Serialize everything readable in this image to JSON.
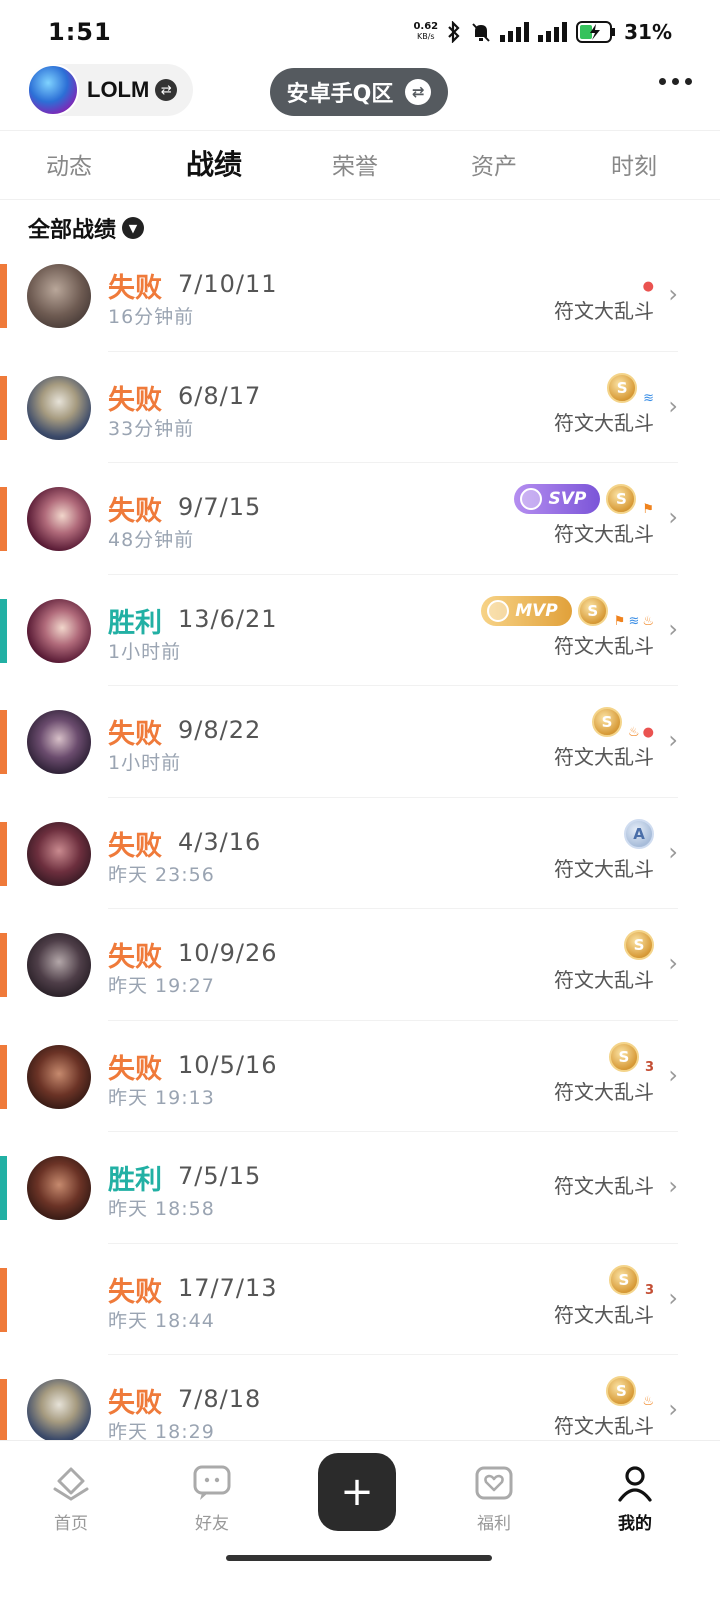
{
  "status_bar": {
    "time": "1:51",
    "net_speed": "0.62",
    "net_unit": "KB/s",
    "battery": "31%"
  },
  "header": {
    "account_name": "LOLM",
    "server": "安卓手Q区"
  },
  "tabs": [
    {
      "label": "动态",
      "active": false
    },
    {
      "label": "战绩",
      "active": true
    },
    {
      "label": "荣誉",
      "active": false
    },
    {
      "label": "资产",
      "active": false
    },
    {
      "label": "时刻",
      "active": false
    }
  ],
  "filter": {
    "label": "全部战绩"
  },
  "badge_text": {
    "svp": "SVP",
    "mvp": "MVP",
    "s": "S",
    "a": "A",
    "three": "3"
  },
  "matches": [
    {
      "result": "失败",
      "outcome": "loss",
      "kda": "7/10/11",
      "time": "16分钟前",
      "mode": "符文大乱斗"
    },
    {
      "result": "失败",
      "outcome": "loss",
      "kda": "6/8/17",
      "time": "33分钟前",
      "mode": "符文大乱斗"
    },
    {
      "result": "失败",
      "outcome": "loss",
      "kda": "9/7/15",
      "time": "48分钟前",
      "mode": "符文大乱斗"
    },
    {
      "result": "胜利",
      "outcome": "win",
      "kda": "13/6/21",
      "time": "1小时前",
      "mode": "符文大乱斗"
    },
    {
      "result": "失败",
      "outcome": "loss",
      "kda": "9/8/22",
      "time": "1小时前",
      "mode": "符文大乱斗"
    },
    {
      "result": "失败",
      "outcome": "loss",
      "kda": "4/3/16",
      "time": "昨天 23:56",
      "mode": "符文大乱斗"
    },
    {
      "result": "失败",
      "outcome": "loss",
      "kda": "10/9/26",
      "time": "昨天 19:27",
      "mode": "符文大乱斗"
    },
    {
      "result": "失败",
      "outcome": "loss",
      "kda": "10/5/16",
      "time": "昨天 19:13",
      "mode": "符文大乱斗"
    },
    {
      "result": "胜利",
      "outcome": "win",
      "kda": "7/5/15",
      "time": "昨天 18:58",
      "mode": "符文大乱斗"
    },
    {
      "result": "失败",
      "outcome": "loss",
      "kda": "17/7/13",
      "time": "昨天 18:44",
      "mode": "符文大乱斗"
    },
    {
      "result": "失败",
      "outcome": "loss",
      "kda": "7/8/18",
      "time": "昨天 18:29",
      "mode": "符文大乱斗"
    }
  ],
  "bottom_nav": [
    {
      "label": "首页",
      "icon": "home-icon",
      "active": false
    },
    {
      "label": "好友",
      "icon": "chat-icon",
      "active": false
    },
    {
      "label": "福利",
      "icon": "gift-heart-icon",
      "active": false
    },
    {
      "label": "我的",
      "icon": "profile-icon",
      "active": true
    }
  ],
  "colors": {
    "loss": "#ef7a3a",
    "win": "#22b0a4",
    "muted": "#9aa4b2"
  }
}
